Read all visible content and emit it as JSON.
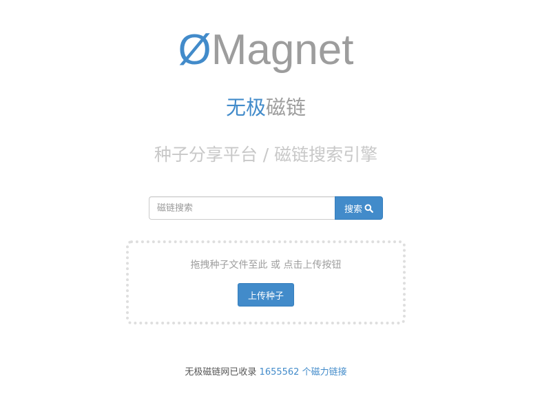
{
  "brand": {
    "logo_mark": "Ø",
    "logo_word": "Magnet",
    "name_accent": "无极",
    "name_rest": "磁链",
    "tagline": "种子分享平台 / 磁链搜索引擎"
  },
  "search": {
    "placeholder": "磁链搜索",
    "value": "",
    "button_label": "搜索",
    "button_icon": "search-icon"
  },
  "upload": {
    "hint": "拖拽种子文件至此 或 点击上传按钮",
    "button_label": "上传种子"
  },
  "footer": {
    "prefix": "无极磁链网已收录",
    "count": "1655562",
    "suffix": "个磁力链接"
  },
  "colors": {
    "accent": "#428bca",
    "muted_text": "#9d9d9d",
    "light_text": "#c8c8c8",
    "dropzone_border": "#dedede"
  }
}
